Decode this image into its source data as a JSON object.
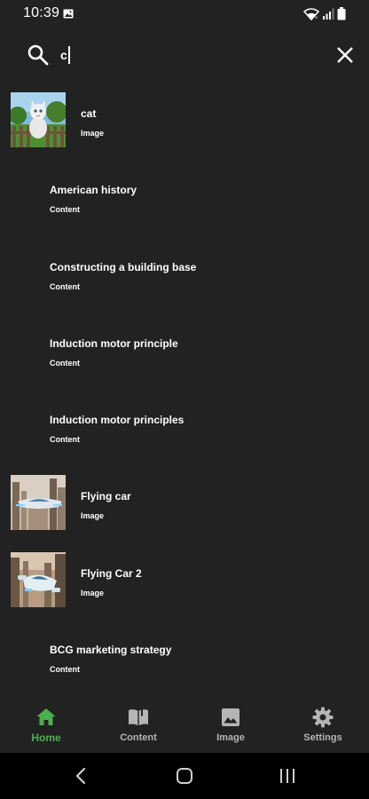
{
  "status_bar": {
    "time": "10:39",
    "icons": [
      "gallery-icon",
      "wifi-icon",
      "signal-icon",
      "battery-icon"
    ]
  },
  "search": {
    "value": "c",
    "icons": [
      "search-icon",
      "close-icon"
    ]
  },
  "results": [
    {
      "title": "cat",
      "type": "Image",
      "thumbnail": "cat-on-fence-thumbnail"
    },
    {
      "title": "American history",
      "type": "Content"
    },
    {
      "title": "Constructing a building base",
      "type": "Content"
    },
    {
      "title": "Induction motor principle",
      "type": "Content"
    },
    {
      "title": "Induction motor principles",
      "type": "Content"
    },
    {
      "title": "Flying car",
      "type": "Image",
      "thumbnail": "flying-car-thumbnail"
    },
    {
      "title": "Flying Car 2",
      "type": "Image",
      "thumbnail": "flying-car-2-thumbnail"
    },
    {
      "title": "BCG marketing strategy",
      "type": "Content"
    }
  ],
  "bottom_nav": {
    "items": [
      {
        "label": "Home",
        "icon": "home-icon",
        "active": true
      },
      {
        "label": "Content",
        "icon": "book-icon",
        "active": false
      },
      {
        "label": "Image",
        "icon": "image-icon",
        "active": false
      },
      {
        "label": "Settings",
        "icon": "gear-icon",
        "active": false
      }
    ]
  },
  "colors": {
    "background": "#222222",
    "accent": "#4caf50",
    "inactive_nav": "#b5b5b5",
    "system_nav": "#000000"
  }
}
